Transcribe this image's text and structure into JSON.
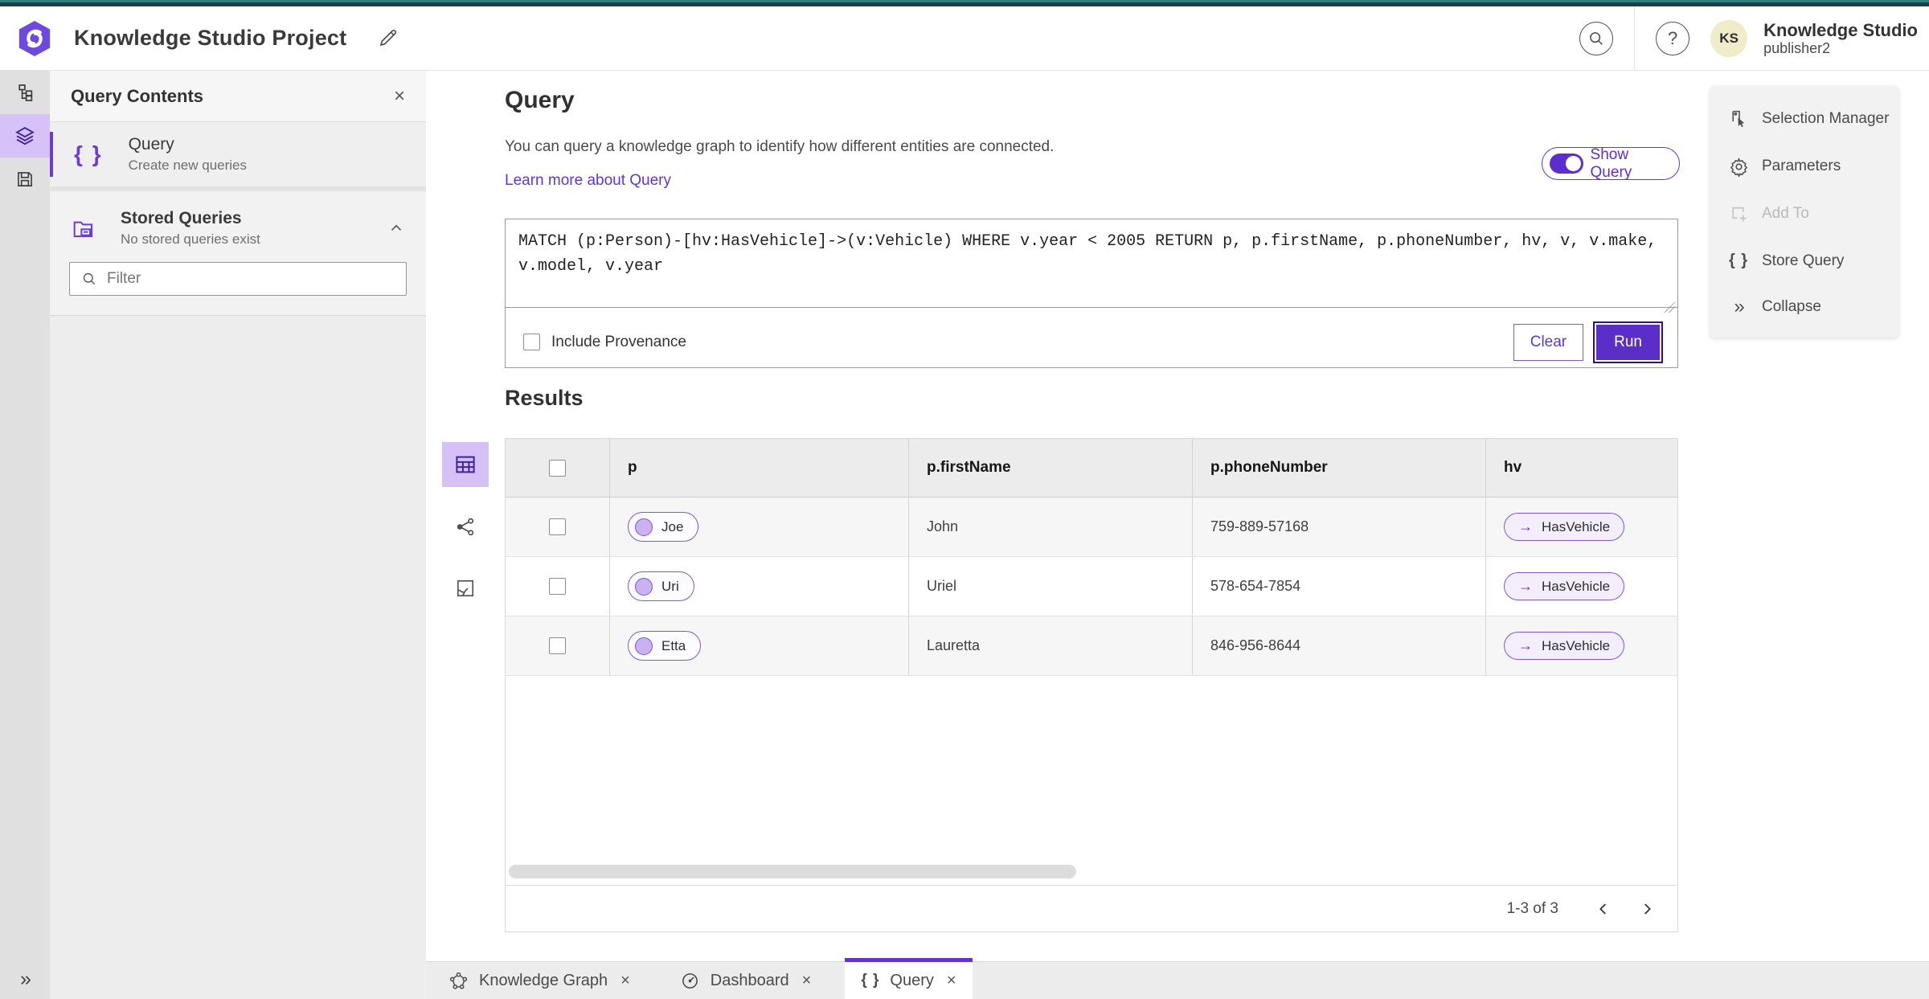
{
  "header": {
    "app_title": "Knowledge Studio Project",
    "user_name": "Knowledge Studio",
    "user_role": "publisher2",
    "avatar_initials": "KS"
  },
  "panel": {
    "title": "Query Contents",
    "query_item": {
      "title": "Query",
      "subtitle": "Create new queries"
    },
    "stored": {
      "title": "Stored Queries",
      "subtitle": "No stored queries exist"
    },
    "filter_placeholder": "Filter"
  },
  "query_section": {
    "title": "Query",
    "description": "You can query a knowledge graph to identify how different entities are connected.",
    "learn_more": "Learn more about Query",
    "show_query_label": "Show Query",
    "query_text": "MATCH (p:Person)-[hv:HasVehicle]->(v:Vehicle) WHERE v.year < 2005 RETURN p, p.firstName, p.phoneNumber, hv, v, v.make, v.model, v.year",
    "include_provenance_label": "Include Provenance",
    "clear_label": "Clear",
    "run_label": "Run"
  },
  "results": {
    "title": "Results",
    "columns": {
      "c1": "p",
      "c2": "p.firstName",
      "c3": "p.phoneNumber",
      "c4": "hv"
    },
    "rows": [
      {
        "p": "Joe",
        "firstName": "John",
        "phone": "759-889-57168",
        "hv": "HasVehicle"
      },
      {
        "p": "Uri",
        "firstName": "Uriel",
        "phone": "578-654-7854",
        "hv": "HasVehicle"
      },
      {
        "p": "Etta",
        "firstName": "Lauretta",
        "phone": "846-956-8644",
        "hv": "HasVehicle"
      }
    ],
    "pagination": {
      "range_text": "1-3 of 3"
    }
  },
  "right_panel": {
    "selection_manager": "Selection Manager",
    "parameters": "Parameters",
    "add_to": "Add To",
    "store_query": "Store Query",
    "collapse": "Collapse"
  },
  "tab_bar": {
    "knowledge_graph": "Knowledge Graph",
    "dashboard": "Dashboard",
    "query": "Query"
  },
  "icons": {
    "close": "×",
    "braces": "{ }",
    "question": "?",
    "arrow_right": "→",
    "collapse_chevrons": "»",
    "rail_expand": "»",
    "gear": "⚙"
  },
  "colors": {
    "accent_purple": "#5e2ecc",
    "accent_light": "#d7c2f7",
    "run_button": "#5b2ec8",
    "top_strip_teal": "#16414d",
    "avatar_bg": "#f0ebc8"
  }
}
